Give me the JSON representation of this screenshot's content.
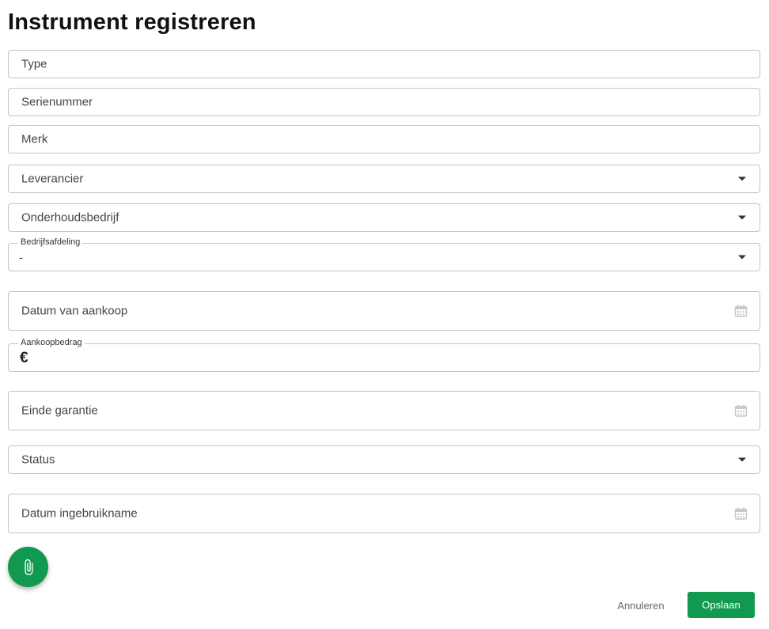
{
  "page_title": "Instrument registreren",
  "fields": {
    "type": {
      "placeholder": "Type"
    },
    "serial": {
      "placeholder": "Serienummer"
    },
    "brand": {
      "placeholder": "Merk"
    },
    "supplier": {
      "placeholder": "Leverancier"
    },
    "maintenance_company": {
      "placeholder": "Onderhoudsbedrijf"
    },
    "department": {
      "label": "Bedrijfsafdeling",
      "value": "-"
    },
    "purchase_date": {
      "placeholder": "Datum van aankoop"
    },
    "purchase_amount": {
      "label": "Aankoopbedrag",
      "currency_symbol": "€"
    },
    "warranty_end": {
      "placeholder": "Einde garantie"
    },
    "status": {
      "placeholder": "Status"
    },
    "commissioning_date": {
      "placeholder": "Datum ingebruikname"
    }
  },
  "actions": {
    "cancel_label": "Annuleren",
    "save_label": "Opslaan"
  },
  "icons": {
    "dropdown": "chevron-down-icon",
    "date": "calendar-icon",
    "attach": "paperclip-icon"
  },
  "colors": {
    "primary": "#119a4f",
    "border": "#c4c4c4",
    "title": "#111111"
  }
}
